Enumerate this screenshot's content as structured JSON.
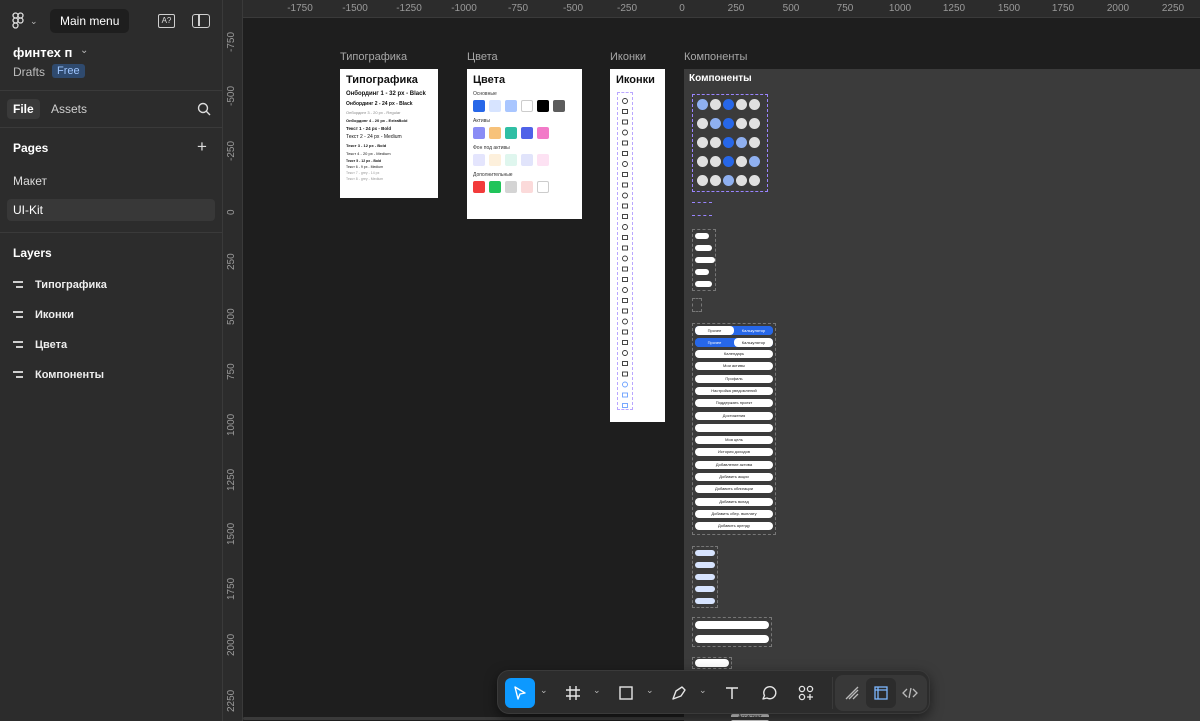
{
  "header": {
    "main_menu_tooltip": "Main menu",
    "file_name": "финтех п",
    "drafts_label": "Drafts",
    "plan_badge": "Free"
  },
  "tabs": {
    "file": "File",
    "assets": "Assets"
  },
  "pages": {
    "heading": "Pages",
    "items": [
      "Макет",
      "UI-Kit"
    ],
    "selected": "UI-Kit"
  },
  "layers": {
    "heading": "Layers",
    "items": [
      "Типографика",
      "Иконки",
      "Цвета",
      "Компоненты"
    ]
  },
  "ruler": {
    "top": [
      "-1750",
      "-1500",
      "-1250",
      "-1000",
      "-750",
      "-500",
      "-250",
      "0",
      "250",
      "500",
      "750",
      "1000",
      "1250",
      "1500",
      "1750",
      "2000",
      "2250"
    ],
    "left": [
      "-750",
      "-500",
      "-250",
      "0",
      "250",
      "500",
      "750",
      "1000",
      "1250",
      "1500",
      "1750",
      "2000",
      "2250"
    ]
  },
  "frames": {
    "typography": {
      "label": "Типографика",
      "title": "Типографика",
      "lines": [
        "Онбординг 1 - 32 px - Black",
        "Онбординг 2 - 24 px - Black",
        "Онбординг 3 - 20 px - Regular",
        "Онбординг 4 - 20 px - ExtraBold",
        "Текст 1 - 24 px - Bold",
        "Текст 2 - 24 px - Medium",
        "Текст 3 - 12 px - Bold",
        "Текст 4 - 20 px - Medium",
        "Текст 5 - 12 px - Bold",
        "Текст 6 - 9 px - Medium",
        "Текст 7 - grey - 14 px",
        "Текст 8 - grey - Medium"
      ]
    },
    "colors": {
      "label": "Цвета",
      "title": "Цвета",
      "groups": [
        {
          "name": "Основные",
          "swatches": [
            "#2767e8",
            "#d7e4ff",
            "#a9c6ff",
            "#ffffff",
            "#000000",
            "#5c5c5c"
          ]
        },
        {
          "name": "Активы",
          "swatches": [
            "#8a8cf5",
            "#f7c27a",
            "#2fbfa4",
            "#4f62e8",
            "#f27ac8"
          ]
        },
        {
          "name": "Фон под активы",
          "swatches": [
            "#e4e5fd",
            "#fdf0dc",
            "#dff6ee",
            "#e1e4fb",
            "#fde2f3"
          ]
        },
        {
          "name": "Дополнительные",
          "swatches": [
            "#f23b3b",
            "#20c45a",
            "#d4d4d4",
            "#fbdada",
            "#ffffff"
          ]
        }
      ]
    },
    "icons": {
      "label": "Иконки",
      "title": "Иконки"
    },
    "components": {
      "label": "Компоненты",
      "title": "Компоненты",
      "segmented": [
        [
          "Прочее",
          "Калькулятор"
        ],
        [
          "Прочее",
          "Калькулятор"
        ]
      ],
      "menu_items": [
        "Календарь",
        "Мои активы",
        "Профиль",
        "Настройка уведомлений",
        "Поддержать проект",
        "Достижения",
        "",
        "Моя цель",
        "История доходов",
        "Добавление актива",
        "Добавить акции",
        "Добавить облигации",
        "Добавить вклад",
        "Добавить сбер. выплату",
        "Добавить аренду"
      ]
    }
  },
  "toolbar": {
    "items": [
      "move-tool",
      "frame-tool",
      "shape-tool",
      "pen-tool",
      "text-tool",
      "comment-tool",
      "actions-tool"
    ],
    "modes": [
      "draw-mode",
      "design-mode",
      "dev-mode"
    ]
  },
  "bottom_tag": "Ассистент"
}
